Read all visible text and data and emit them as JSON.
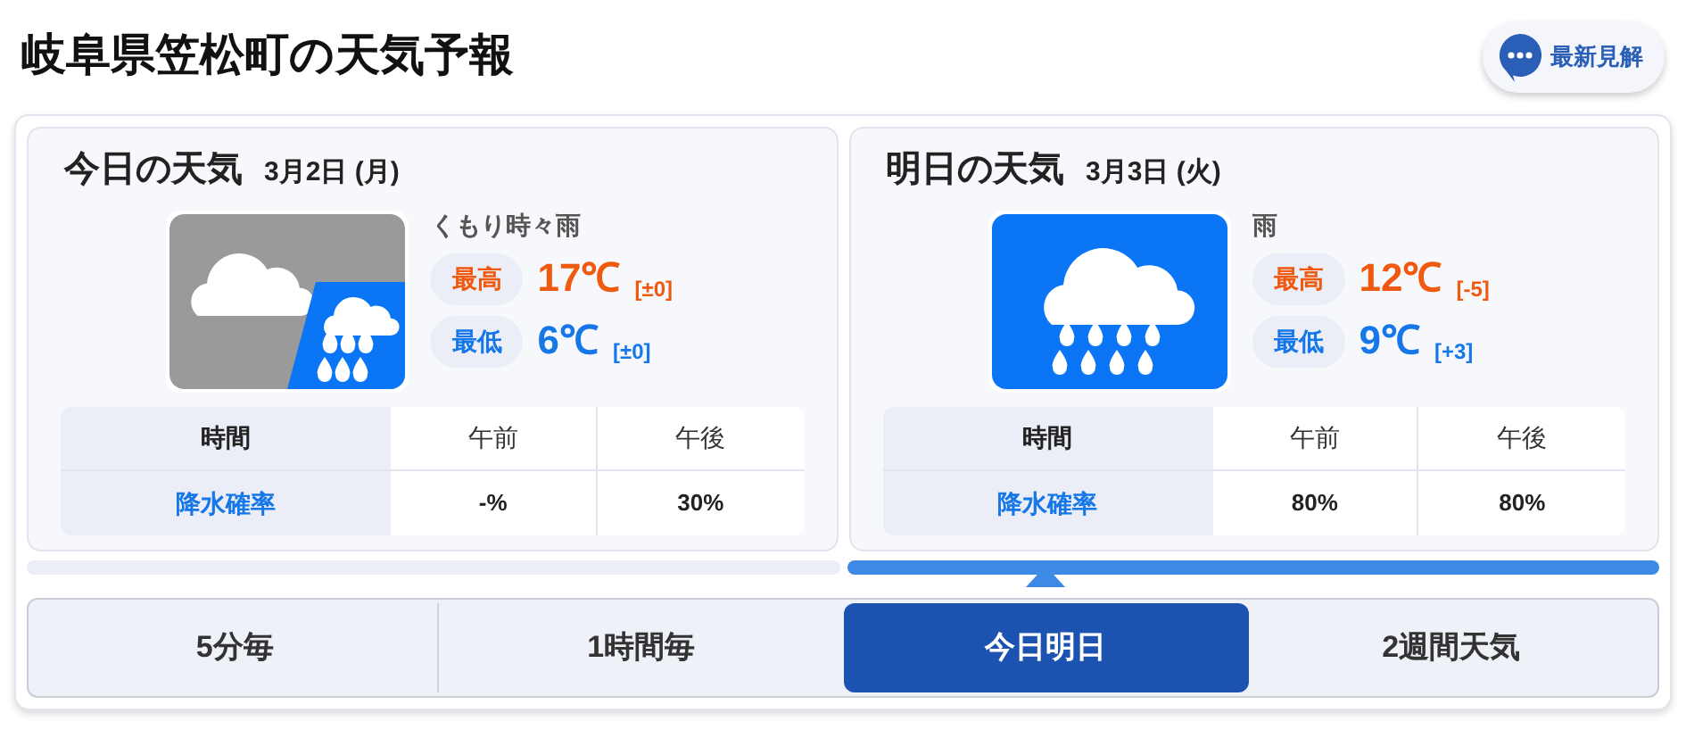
{
  "title": "岐阜県笠松町の天気予報",
  "opinion_button": {
    "label": "最新見解"
  },
  "days": [
    {
      "heading": "今日の天気",
      "date": "3月2日 (月)",
      "kind": "cloudy_rain",
      "weather": "くもり時々雨",
      "high_label": "最高",
      "high": "17℃",
      "high_diff": "[±0]",
      "low_label": "最低",
      "low": "6℃",
      "low_diff": "[±0]",
      "table": {
        "header": [
          "時間",
          "午前",
          "午後"
        ],
        "row": [
          "降水確率",
          "-%",
          "30%"
        ]
      }
    },
    {
      "heading": "明日の天気",
      "date": "3月3日 (火)",
      "kind": "rain",
      "weather": "雨",
      "high_label": "最高",
      "high": "12℃",
      "high_diff": "[-5]",
      "low_label": "最低",
      "low": "9℃",
      "low_diff": "[+3]",
      "table": {
        "header": [
          "時間",
          "午前",
          "午後"
        ],
        "row": [
          "降水確率",
          "80%",
          "80%"
        ]
      }
    }
  ],
  "pager": [
    {
      "selected": false
    },
    {
      "selected": true
    }
  ],
  "tabs": [
    {
      "label": "5分毎",
      "selected": false
    },
    {
      "label": "1時間毎",
      "selected": false
    },
    {
      "label": "今日明日",
      "selected": true
    },
    {
      "label": "2週間天気",
      "selected": false
    }
  ]
}
